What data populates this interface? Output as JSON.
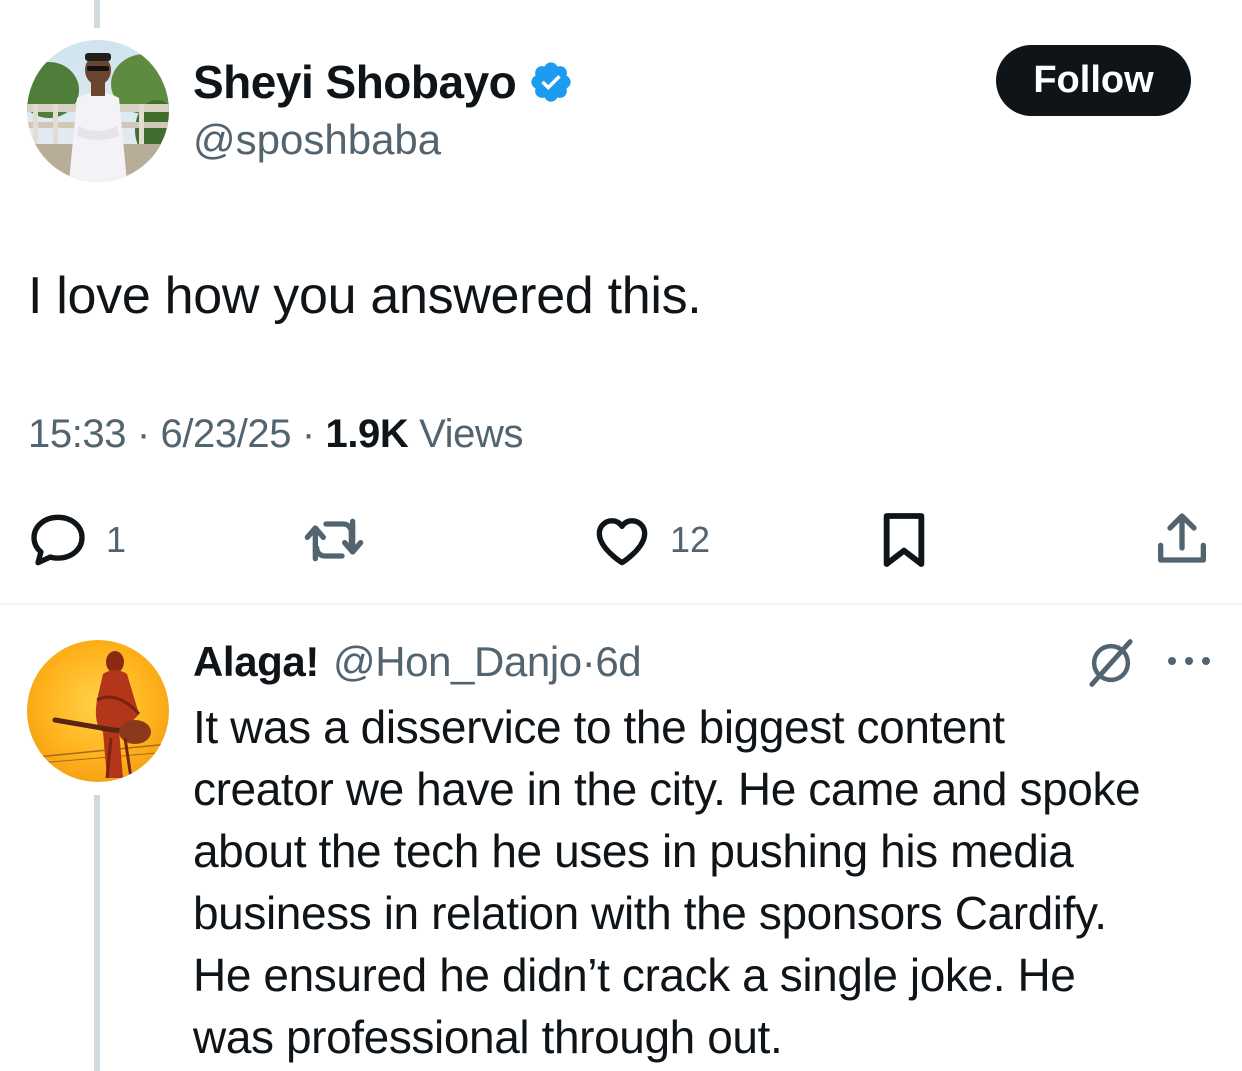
{
  "tweet": {
    "author_name": "Sheyi Shobayo",
    "author_handle": "@sposhbaba",
    "follow_label": "Follow",
    "text": "I love how you answered this.",
    "time": "15:33",
    "separator": "·",
    "date": "6/23/25",
    "views_count": "1.9K",
    "views_label": "Views",
    "replies_count": "1",
    "likes_count": "12"
  },
  "reply": {
    "author_name": "Alaga!",
    "author_handle": "@Hon_Danjo",
    "separator": "·",
    "time": "6d",
    "text_lines": [
      "It was a disservice to the biggest content",
      "creator we have in the city. He came and spoke",
      "about the tech he uses in pushing his media",
      "business in relation with the sponsors Cardify.",
      "He ensured he didn’t crack a single joke. He",
      "was professional through out."
    ]
  },
  "icons": {
    "verified": "verified-badge-icon",
    "reply": "reply-icon",
    "retweet": "retweet-icon",
    "like": "heart-icon",
    "bookmark": "bookmark-icon",
    "share": "share-icon",
    "grok": "grok-icon",
    "more": "more-icon"
  },
  "colors": {
    "text_primary": "#0f1419",
    "text_secondary": "#536471",
    "verified_blue": "#1d9bf0",
    "button_bg": "#0f1419",
    "divider": "#eff3f4",
    "thread_line": "#cfd9de"
  }
}
